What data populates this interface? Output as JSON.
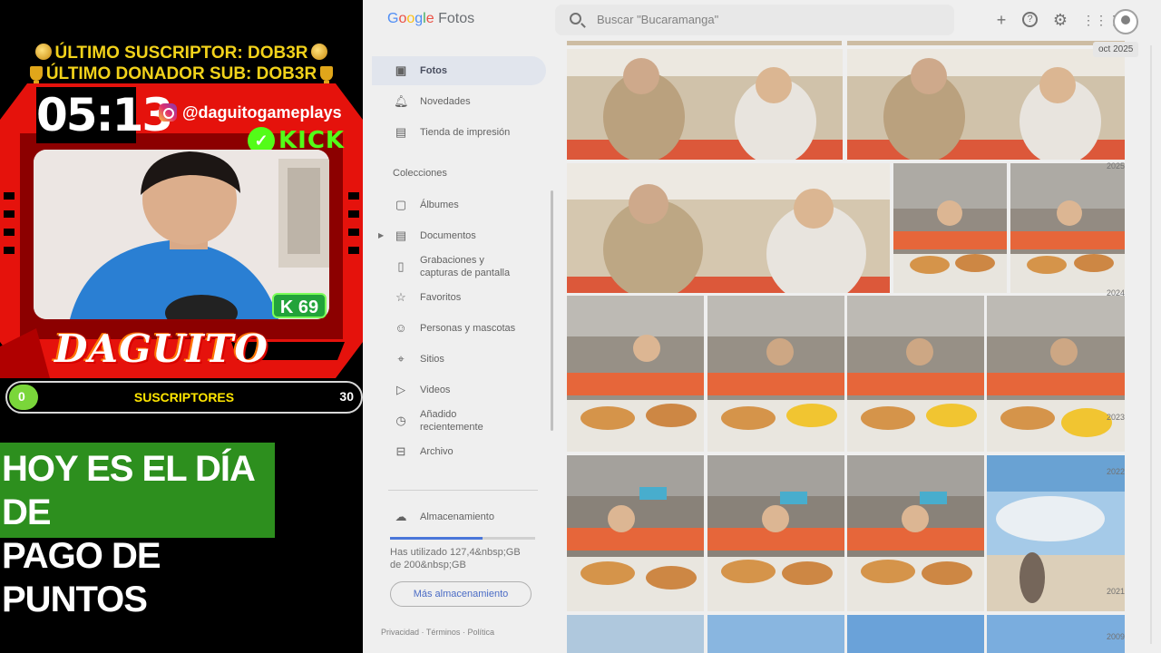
{
  "overlay": {
    "last_subscriber": "ÚLTIMO SUSCRIPTOR: DOB3R",
    "last_donor": "ÚLTIMO DONADOR SUB: DOB3R",
    "timer": "05:13",
    "instagram": "@daguitogameplays",
    "kick": "KICK",
    "kick_badge": "K 69",
    "streamer_logo": "DAGUITO",
    "subs": {
      "label": "SUSCRIPTORES",
      "current": "0",
      "goal": "30",
      "progress": 0.0
    },
    "banner_line1": "HOY ES EL DÍA DE",
    "banner_line2": "PAGO DE PUNTOS",
    "colors": {
      "frame_red": "#e5120c",
      "ticker_yellow": "#f2d21a",
      "banner_green": "#2d8f1e",
      "kick_green": "#53fc18"
    }
  },
  "photos_app": {
    "logo_google": "Google",
    "logo_fotos": "Fotos",
    "search_placeholder": "Buscar \"Bucaramanga\"",
    "top_icons": [
      "add-icon",
      "help-icon",
      "settings-icon",
      "apps-grid-icon",
      "account-avatar"
    ],
    "nav": {
      "photos": "Fotos",
      "updates": "Novedades",
      "print_store": "Tienda de impresión",
      "collections_title": "Colecciones",
      "albums": "Álbumes",
      "documents": "Documentos",
      "recordings_1": "Grabaciones y",
      "recordings_2": "capturas de pantalla",
      "favorites": "Favoritos",
      "people": "Personas y mascotas",
      "places": "Sitios",
      "videos": "Videos",
      "recent_1": "Añadido",
      "recent_2": "recientemente",
      "archive": "Archivo"
    },
    "storage": {
      "label": "Almacenamiento",
      "used_1": "Has utilizado 127,4&nbsp;GB",
      "used_2": "de 200&nbsp;GB",
      "used_fraction": 0.637,
      "more_button": "Más almacenamiento"
    },
    "footer": {
      "privacy": "Privacidad",
      "terms": "Términos",
      "policy": "Política",
      "sep": "·"
    },
    "timeline": {
      "month": "oct 2025",
      "years": [
        "2025",
        "2024",
        "2023",
        "2022",
        "2021",
        "2009"
      ]
    }
  }
}
